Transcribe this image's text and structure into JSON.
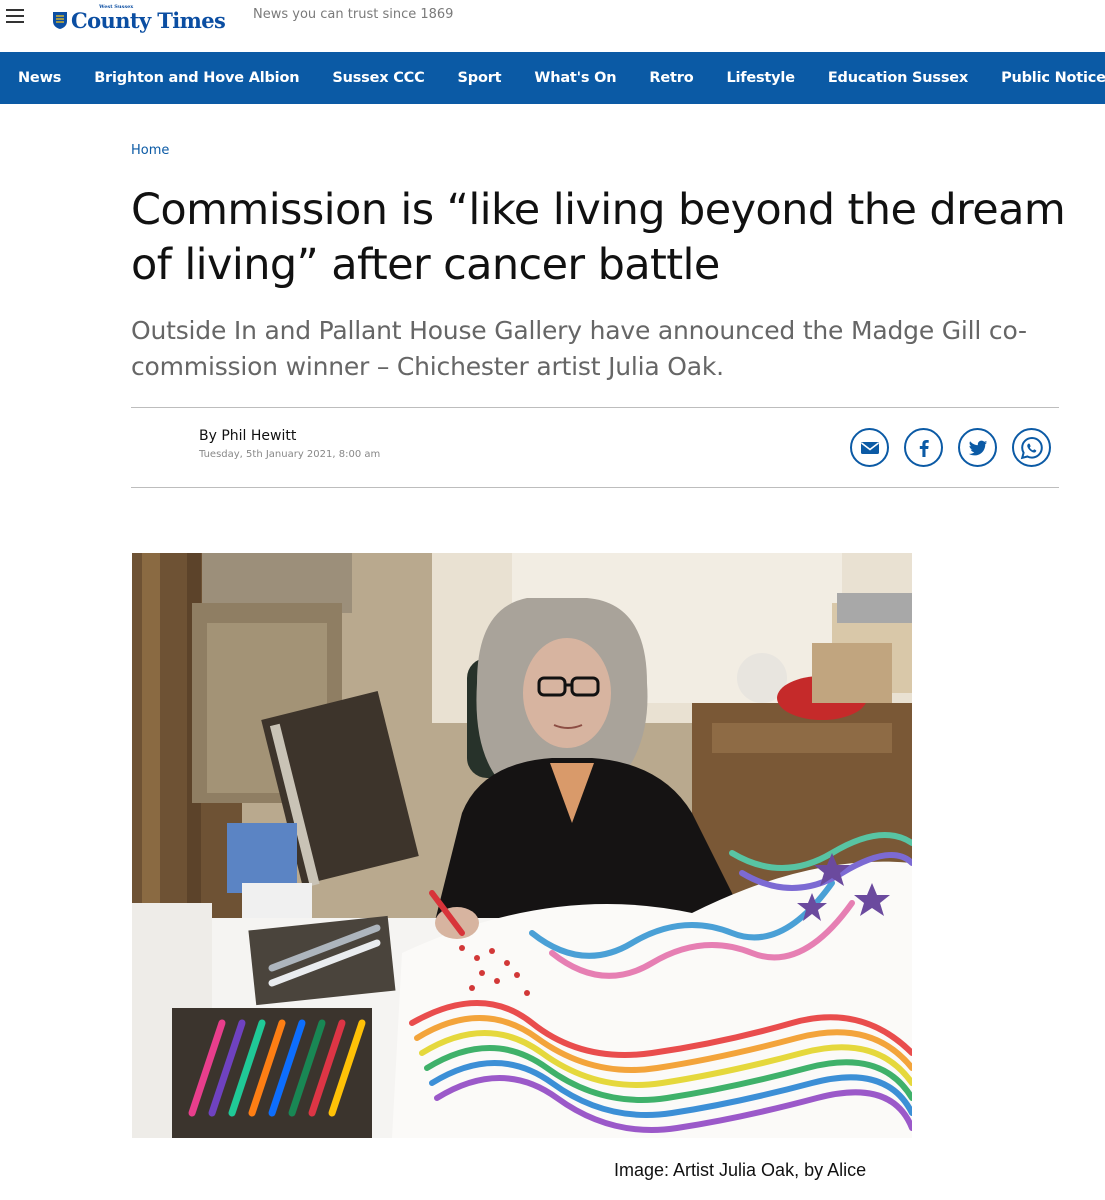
{
  "header": {
    "menu_icon": "hamburger-icon",
    "logo_kicker": "West Sussex",
    "logo_text": "County Times",
    "tagline": "News you can trust since 1869"
  },
  "nav": {
    "items": [
      {
        "label": "News"
      },
      {
        "label": "Brighton and Hove Albion"
      },
      {
        "label": "Sussex CCC"
      },
      {
        "label": "Sport"
      },
      {
        "label": "What's On"
      },
      {
        "label": "Retro"
      },
      {
        "label": "Lifestyle"
      },
      {
        "label": "Education Sussex"
      },
      {
        "label": "Public Notices"
      }
    ]
  },
  "article": {
    "breadcrumb": "Home",
    "headline": "Commission is “like living beyond the dream of living” after cancer battle",
    "standfirst": "Outside In and Pallant House Gallery have announced the Madge Gill co-commission winner – Chichester artist Julia Oak.",
    "author": "By Phil Hewitt",
    "date": "Tuesday, 5th January 2021, 8:00 am",
    "share_icons": [
      "email-icon",
      "facebook-icon",
      "twitter-icon",
      "whatsapp-icon"
    ],
    "image_caption": "Image: Artist Julia Oak, by Alice"
  },
  "colors": {
    "brand_blue": "#0b5aa5",
    "text_dark": "#111111",
    "text_grey": "#666666"
  }
}
